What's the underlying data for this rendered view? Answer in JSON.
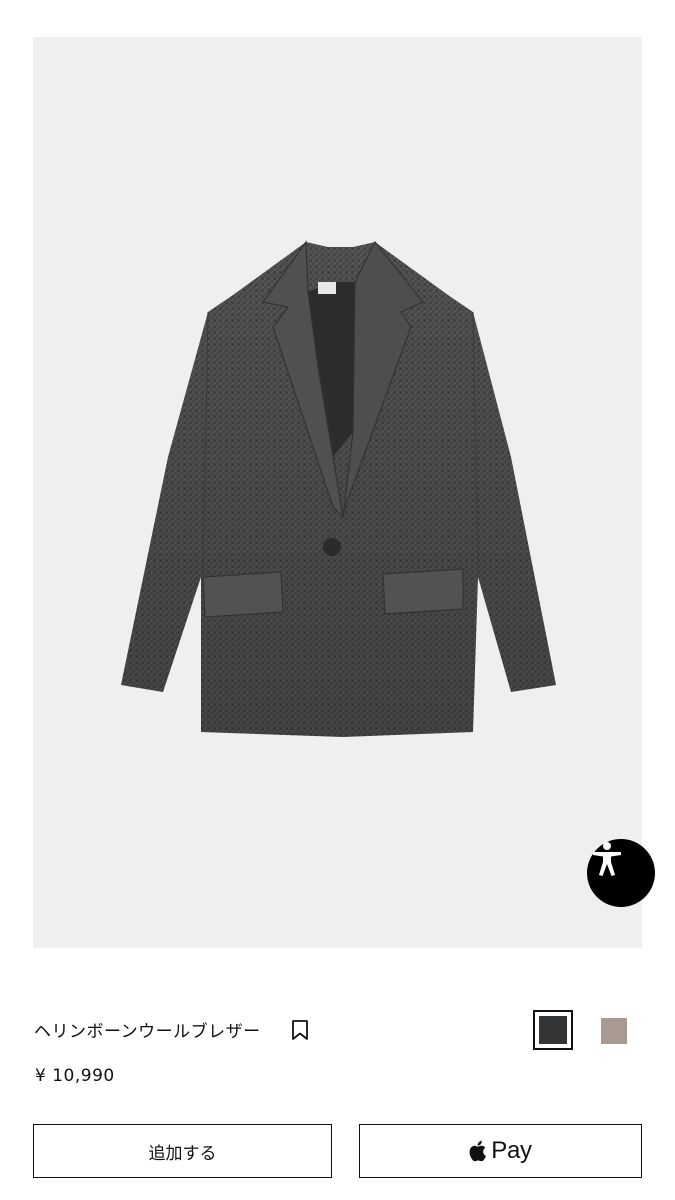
{
  "product": {
    "name": "ヘリンボーンウールブレザー",
    "price": "¥ 10,990",
    "image_alt": "herringbone-wool-blazer",
    "colors": [
      {
        "name": "charcoal",
        "hex": "#333436",
        "selected": true
      },
      {
        "name": "taupe",
        "hex": "#a89a90",
        "selected": false
      }
    ]
  },
  "actions": {
    "add_label": "追加する",
    "applepay_label": "Pay"
  },
  "icons": {
    "bookmark": "bookmark-icon",
    "accessibility": "accessibility-icon",
    "apple": "apple-logo-icon"
  },
  "theme": {
    "image_bg": "#efefef",
    "text": "#111111",
    "accessibility_bg": "#000000"
  }
}
